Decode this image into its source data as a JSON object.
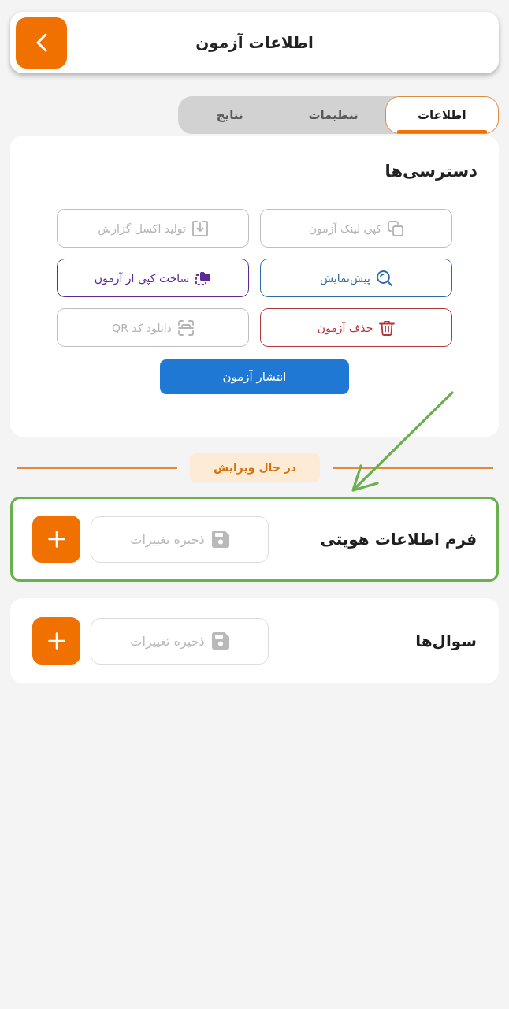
{
  "header": {
    "title": "اطلاعات آزمون"
  },
  "tabs": [
    {
      "label": "اطلاعات",
      "selected": true
    },
    {
      "label": "تنظیمات",
      "selected": false
    },
    {
      "label": "نتایج",
      "selected": false
    }
  ],
  "access": {
    "title": "دسترسی‌ها",
    "actions": [
      {
        "label": "کپی لینک آزمون",
        "disabled": true
      },
      {
        "label": "تولید اکسل گزارش",
        "disabled": true
      },
      {
        "label": "پیش‌نمایش",
        "disabled": false,
        "color": "#2d6aa8"
      },
      {
        "label": "ساخت کپی از آزمون",
        "disabled": false,
        "color": "#5b2a92"
      },
      {
        "label": "حذف آزمون",
        "disabled": false,
        "color": "#b3363a"
      },
      {
        "label": "دانلود کد QR",
        "disabled": true
      }
    ],
    "publish_button": {
      "label": "انتشار آزمون"
    }
  },
  "status_divider": {
    "label": "در حال ویرایش"
  },
  "sections": [
    {
      "title": "فرم اطلاعات هویتی",
      "save_label": "ذخیره تغییرات",
      "save_disabled": true,
      "highlighted": true
    },
    {
      "title": "سوال‌ها",
      "save_label": "ذخیره تغییرات",
      "save_disabled": true,
      "highlighted": false
    }
  ],
  "annotation": {
    "arrow": true
  }
}
